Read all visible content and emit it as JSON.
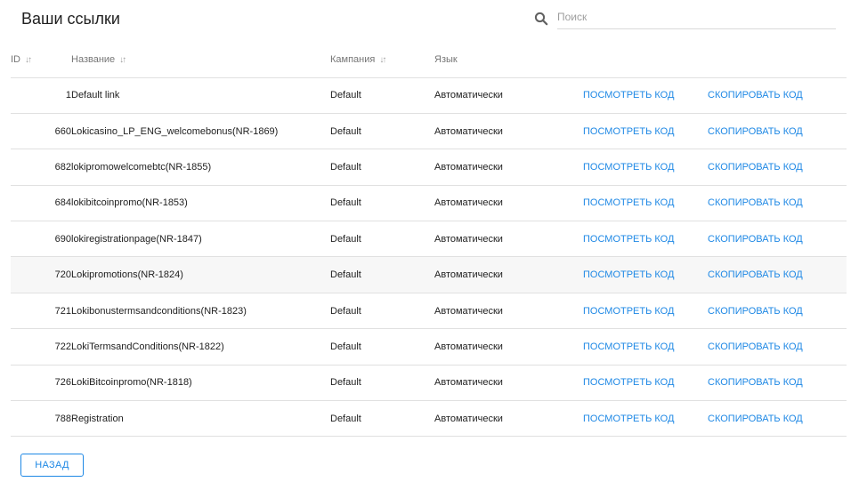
{
  "header": {
    "title": "Ваши ссылки"
  },
  "search": {
    "placeholder": "Поиск",
    "value": ""
  },
  "table": {
    "columns": {
      "id": "ID",
      "name": "Название",
      "campaign": "Кампания",
      "language": "Язык"
    },
    "rows": [
      {
        "id": "1",
        "name": "Default link",
        "campaign": "Default",
        "language": "Автоматически",
        "view": "ПОСМОТРЕТЬ КОД",
        "copy": "СКОПИРОВАТЬ КОД"
      },
      {
        "id": "660",
        "name": "Lokicasino_LP_ENG_welcomebonus(NR-1869)",
        "campaign": "Default",
        "language": "Автоматически",
        "view": "ПОСМОТРЕТЬ КОД",
        "copy": "СКОПИРОВАТЬ КОД"
      },
      {
        "id": "682",
        "name": "lokipromowelcomebtc(NR-1855)",
        "campaign": "Default",
        "language": "Автоматически",
        "view": "ПОСМОТРЕТЬ КОД",
        "copy": "СКОПИРОВАТЬ КОД"
      },
      {
        "id": "684",
        "name": "lokibitcoinpromo(NR-1853)",
        "campaign": "Default",
        "language": "Автоматически",
        "view": "ПОСМОТРЕТЬ КОД",
        "copy": "СКОПИРОВАТЬ КОД"
      },
      {
        "id": "690",
        "name": "lokiregistrationpage(NR-1847)",
        "campaign": "Default",
        "language": "Автоматически",
        "view": "ПОСМОТРЕТЬ КОД",
        "copy": "СКОПИРОВАТЬ КОД"
      },
      {
        "id": "720",
        "name": "Lokipromotions(NR-1824)",
        "campaign": "Default",
        "language": "Автоматически",
        "view": "ПОСМОТРЕТЬ КОД",
        "copy": "СКОПИРОВАТЬ КОД"
      },
      {
        "id": "721",
        "name": "Lokibonustermsandconditions(NR-1823)",
        "campaign": "Default",
        "language": "Автоматически",
        "view": "ПОСМОТРЕТЬ КОД",
        "copy": "СКОПИРОВАТЬ КОД"
      },
      {
        "id": "722",
        "name": "LokiTermsandConditions(NR-1822)",
        "campaign": "Default",
        "language": "Автоматически",
        "view": "ПОСМОТРЕТЬ КОД",
        "copy": "СКОПИРОВАТЬ КОД"
      },
      {
        "id": "726",
        "name": "LokiBitcoinpromo(NR-1818)",
        "campaign": "Default",
        "language": "Автоматически",
        "view": "ПОСМОТРЕТЬ КОД",
        "copy": "СКОПИРОВАТЬ КОД"
      },
      {
        "id": "788",
        "name": "Registration",
        "campaign": "Default",
        "language": "Автоматически",
        "view": "ПОСМОТРЕТЬ КОД",
        "copy": "СКОПИРОВАТЬ КОД"
      }
    ]
  },
  "footer": {
    "back_label": "НАЗАД"
  },
  "colors": {
    "accent": "#1e88e5",
    "row_highlight": "#f7f7f7",
    "divider": "#e0e0e0"
  }
}
